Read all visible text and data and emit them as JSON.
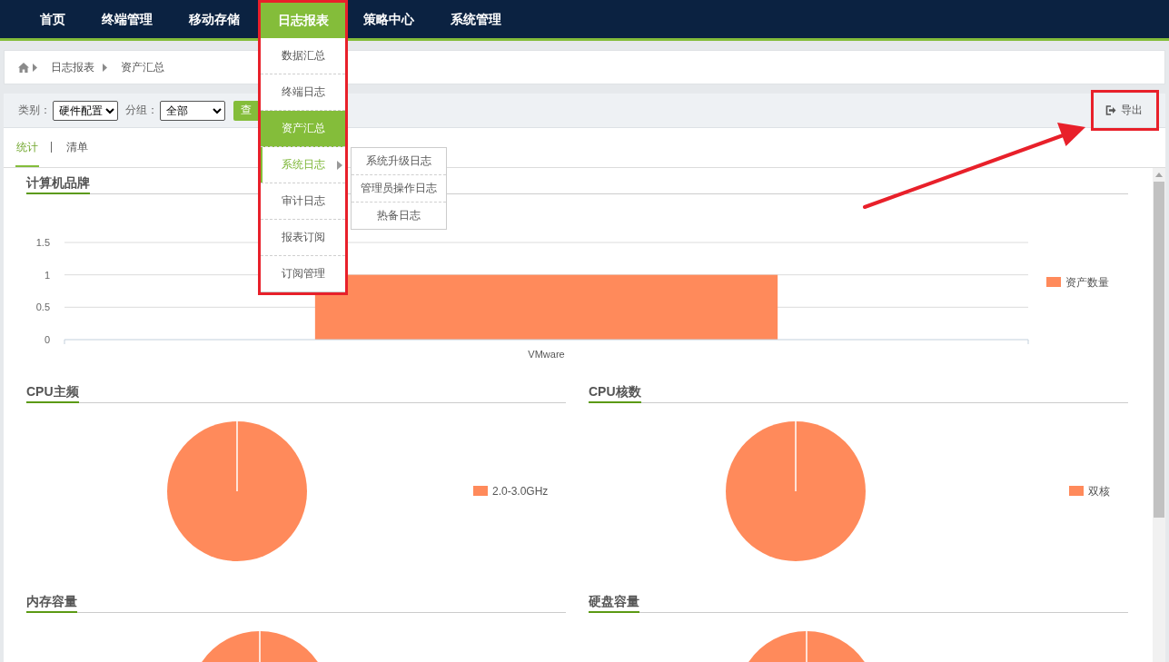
{
  "nav": {
    "items": [
      {
        "label": "首页",
        "selected": false,
        "highlighted": false
      },
      {
        "label": "终端管理",
        "selected": false,
        "highlighted": false
      },
      {
        "label": "移动存储",
        "selected": false,
        "highlighted": false
      },
      {
        "label": "日志报表",
        "selected": true,
        "highlighted": true,
        "menu": [
          {
            "label": "数据汇总",
            "selected": false,
            "expanded": false
          },
          {
            "label": "终端日志",
            "selected": false,
            "expanded": false
          },
          {
            "label": "资产汇总",
            "selected": true,
            "expanded": false
          },
          {
            "label": "系统日志",
            "selected": false,
            "expanded": true,
            "children": [
              {
                "label": "系统升级日志"
              },
              {
                "label": "管理员操作日志"
              },
              {
                "label": "热备日志"
              }
            ]
          },
          {
            "label": "审计日志",
            "selected": false,
            "expanded": false
          },
          {
            "label": "报表订阅",
            "selected": false,
            "expanded": false
          },
          {
            "label": "订阅管理",
            "selected": false,
            "expanded": false
          }
        ]
      },
      {
        "label": "策略中心",
        "selected": false,
        "highlighted": false
      },
      {
        "label": "系统管理",
        "selected": false,
        "highlighted": false
      }
    ]
  },
  "breadcrumb": [
    "日志报表",
    "资产汇总"
  ],
  "toolbar": {
    "filters": [
      {
        "label": "类别：",
        "value": "硬件配置"
      },
      {
        "label": "分组：",
        "value": "全部"
      }
    ],
    "query_button": "查",
    "export_button": {
      "label": "导出",
      "highlighted": true,
      "arrow": true
    }
  },
  "tabs": [
    {
      "label": "统计",
      "selected": true
    },
    {
      "label": "清单",
      "selected": false
    }
  ],
  "sections": [
    {
      "title": "计算机品牌",
      "kind": "bar",
      "chart_data": {
        "type": "bar",
        "categories": [
          "VMware"
        ],
        "series": [
          {
            "name": "资产数量",
            "color": "#ff8a5b",
            "values": [
              1
            ]
          }
        ],
        "ylim": [
          0,
          1.5
        ],
        "yticks": [
          0,
          0.5,
          1,
          1.5
        ]
      }
    },
    {
      "title": "CPU主频",
      "kind": "pie",
      "legend": [
        "2.0-3.0GHz"
      ]
    },
    {
      "title": "CPU核数",
      "kind": "pie",
      "legend": [
        "双核"
      ]
    },
    {
      "title": "内存容量",
      "kind": "pie"
    },
    {
      "title": "硬盘容量",
      "kind": "pie"
    }
  ]
}
